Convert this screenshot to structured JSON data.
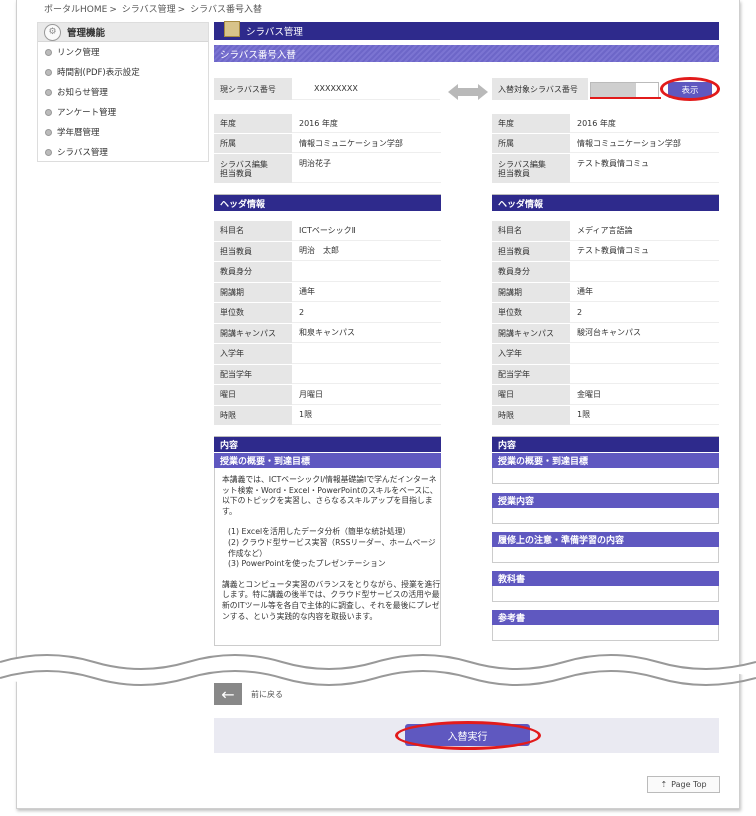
{
  "breadcrumb": [
    "ポータルHOME",
    "シラバス管理",
    "シラバス番号入替"
  ],
  "sidebar": {
    "title": "管理機能",
    "items": [
      {
        "label": "リンク管理"
      },
      {
        "label": "時間割(PDF)表示設定"
      },
      {
        "label": "お知らせ管理"
      },
      {
        "label": "アンケート管理"
      },
      {
        "label": "学年暦管理"
      },
      {
        "label": "シラバス管理"
      }
    ]
  },
  "main": {
    "title": "シラバス管理",
    "subtitle": "シラバス番号入替",
    "left_number_label": "現シラバス番号",
    "left_number_value": "XXXXXXXX",
    "right_number_label": "入替対象シラバス番号",
    "show_button": "表示"
  },
  "left": {
    "meta": [
      {
        "label": "年度",
        "value": "2016 年度"
      },
      {
        "label": "所属",
        "value": "情報コミュニケーション学部"
      },
      {
        "label": "シラバス編集\n担当教員",
        "value": "明治花子"
      }
    ],
    "header_title": "ヘッダ情報",
    "header": [
      {
        "label": "科目名",
        "value": "ICTベーシックⅡ"
      },
      {
        "label": "担当教員",
        "value": "明治　太郎"
      },
      {
        "label": "教員身分",
        "value": ""
      },
      {
        "label": "開講期",
        "value": "通年"
      },
      {
        "label": "単位数",
        "value": "2"
      },
      {
        "label": "開講キャンパス",
        "value": "和泉キャンパス"
      },
      {
        "label": "入学年",
        "value": ""
      },
      {
        "label": "配当学年",
        "value": ""
      },
      {
        "label": "曜日",
        "value": "月曜日"
      },
      {
        "label": "時限",
        "value": "1限"
      }
    ],
    "content_title": "内容",
    "content_sub": "授業の概要・到達目標",
    "content_paragraphs": [
      "本講義では、ICTベーシックI/情報基礎論Iで学んだインターネット検索・Word・Excel・PowerPointのスキルをベースに、以下のトピックを実習し、さらなるスキルアップを目指します。",
      "(1) Excelを活用したデータ分析（簡単な統計処理）\n(2) クラウド型サービス実習（RSSリーダー、ホームページ作成など）\n(3) PowerPointを使ったプレゼンテーション",
      "講義とコンピュータ実習のバランスをとりながら、授業を進行します。特に講義の後半では、クラウド型サービスの活用や最新のITツール等を各自で主体的に調査し、それを最後にプレゼンする、という実践的な内容を取扱います。"
    ]
  },
  "right": {
    "meta": [
      {
        "label": "年度",
        "value": "2016 年度"
      },
      {
        "label": "所属",
        "value": "情報コミュニケーション学部"
      },
      {
        "label": "シラバス編集\n担当教員",
        "value": "テスト教員情コミュ"
      }
    ],
    "header_title": "ヘッダ情報",
    "header": [
      {
        "label": "科目名",
        "value": "メディア言語論"
      },
      {
        "label": "担当教員",
        "value": "テスト教員情コミュ"
      },
      {
        "label": "教員身分",
        "value": ""
      },
      {
        "label": "開講期",
        "value": "通年"
      },
      {
        "label": "単位数",
        "value": "2"
      },
      {
        "label": "開講キャンパス",
        "value": "駿河台キャンパス"
      },
      {
        "label": "入学年",
        "value": ""
      },
      {
        "label": "配当学年",
        "value": ""
      },
      {
        "label": "曜日",
        "value": "金曜日"
      },
      {
        "label": "時限",
        "value": "1限"
      }
    ],
    "content_title": "内容",
    "content_sub": "授業の概要・到達目標",
    "sections": [
      "授業内容",
      "履修上の注意・準備学習の内容",
      "教科書",
      "参考書"
    ]
  },
  "footer": {
    "back_label": "前に戻る",
    "execute_button": "入替実行",
    "page_top": "Page Top"
  },
  "colors": {
    "navy": "#2e2a8c",
    "purple": "#5f58c0",
    "highlight": "#e21b1b"
  }
}
